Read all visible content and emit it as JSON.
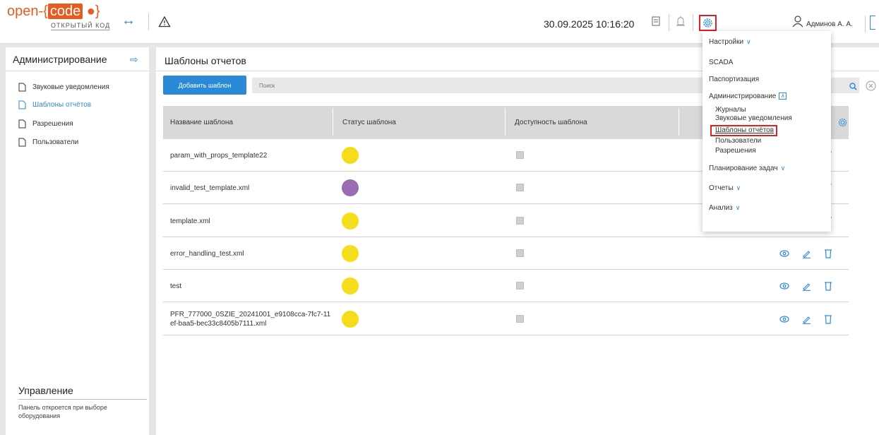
{
  "header": {
    "logo_main": "open-{",
    "logo_box": "code",
    "logo_tail": "}",
    "logo_sub": "ОТКРЫТЫЙ КОД",
    "datetime": "30.09.2025 10:16:20",
    "user_name": "Админов А. А."
  },
  "sidebar": {
    "title": "Администрирование",
    "items": [
      {
        "label": "Звуковые уведомления",
        "active": false
      },
      {
        "label": "Шаблоны отчётов",
        "active": true
      },
      {
        "label": "Разрешения",
        "active": false
      },
      {
        "label": "Пользователи",
        "active": false
      }
    ],
    "management_title": "Управление",
    "management_text": "Панель откроется при выборе оборудования"
  },
  "main": {
    "title": "Шаблоны отчетов",
    "add_button": "Добавить шаблон",
    "search_placeholder": "Поиск",
    "columns": [
      "Название шаблона",
      "Статус шаблона",
      "Доступность шаблона"
    ],
    "rows": [
      {
        "name": "param_with_props_template22",
        "status_color": "#f5dd1c"
      },
      {
        "name": "invalid_test_template.xml",
        "status_color": "#9b6bb4"
      },
      {
        "name": "template.xml",
        "status_color": "#f5dd1c"
      },
      {
        "name": "error_handling_test.xml",
        "status_color": "#f5dd1c"
      },
      {
        "name": "test",
        "status_color": "#f5dd1c"
      },
      {
        "name": "PFR_777000_0SZIE_20241001_e9108cca-7fc7-11ef-baa5-bec33c8405b7111.xml",
        "status_color": "#f5dd1c"
      }
    ]
  },
  "menu": {
    "settings": "Настройки",
    "scada": "SCADA",
    "passport": "Паспортизация",
    "admin": "Администрирование",
    "admin_sub": [
      "Журналы",
      "Звуковые уведомления",
      "Шаблоны отчётов",
      "Пользователи",
      "Разрешения"
    ],
    "planning": "Планирование задач",
    "reports": "Отчеты",
    "analysis": "Анализ"
  },
  "colors": {
    "accent": "#2b8ad8",
    "highlight": "#e02020",
    "logo": "#e85b20"
  }
}
